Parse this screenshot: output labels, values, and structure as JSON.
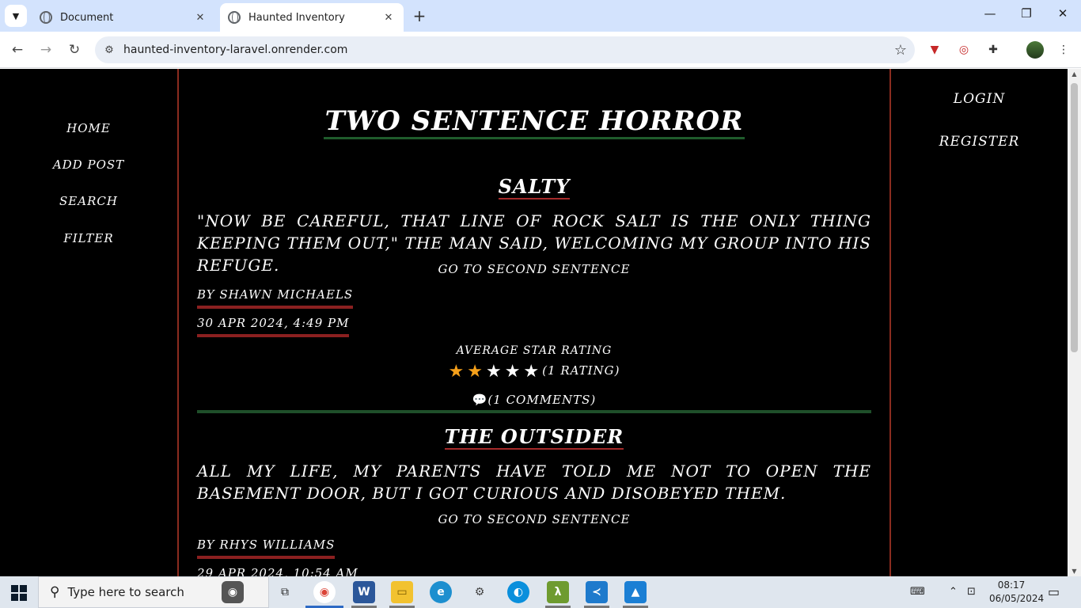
{
  "browser": {
    "tabs": [
      {
        "title": "Document",
        "active": false
      },
      {
        "title": "Haunted Inventory",
        "active": true
      }
    ],
    "url": "haunted-inventory-laravel.onrender.com"
  },
  "nav_left": {
    "items": [
      "Home",
      "Add Post",
      "Search",
      "Filter"
    ]
  },
  "nav_right": {
    "items": [
      "Login",
      "Register"
    ]
  },
  "site": {
    "title": "Two Sentence Horror"
  },
  "posts": [
    {
      "title": "Salty",
      "first_sentence": "\"Now be careful, that line of rock salt is the only thing keeping them out,\" the man said, welcoming my group into his refuge.",
      "second_link": "Go to second sentence",
      "author": "By Shawn Michaels",
      "date": "30 Apr 2024, 4:49 PM",
      "rating_label": "Average Star Rating",
      "rating_value": 2,
      "rating_max": 5,
      "rating_count_text": "(1 rating)",
      "comments_text": "(1 comments)"
    },
    {
      "title": "The Outsider",
      "first_sentence": "All my life, my parents have told me not to open the basement door, but I got curious and disobeyed them.",
      "second_link": "Go to second sentence",
      "author": "By Rhys Williams",
      "date": "29 Apr 2024, 10:54 AM"
    }
  ],
  "taskbar": {
    "search_placeholder": "Type here to search",
    "time": "08:17",
    "date": "06/05/2024"
  },
  "colors": {
    "background": "#000000",
    "border": "#8b2c1f",
    "title_underline": "#1f5c2c",
    "star_filled": "#f5a01a",
    "meta_underline": "#8b2020"
  }
}
